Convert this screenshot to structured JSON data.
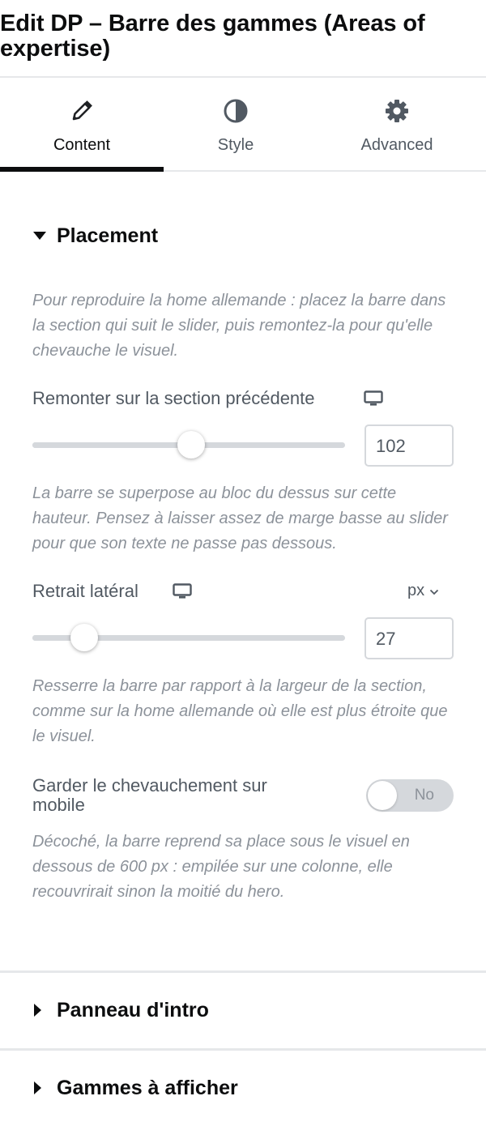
{
  "header": {
    "title": "Edit DP – Barre des gammes (Areas of expertise)"
  },
  "tabs": [
    {
      "label": "Content",
      "icon": "pencil-icon",
      "active": true
    },
    {
      "label": "Style",
      "icon": "half-circle-icon",
      "active": false
    },
    {
      "label": "Advanced",
      "icon": "gear-icon",
      "active": false
    }
  ],
  "placement": {
    "title": "Placement",
    "intro": "Pour reproduire la home allemande : placez la barre dans la section qui suit le slider, puis remontez-la pour qu'elle chevauche le visuel.",
    "remonter": {
      "label": "Remonter sur la section précédente",
      "value": "102",
      "slider_fraction": 0.51,
      "help": "La barre se superpose au bloc du dessus sur cette hauteur. Pensez à laisser assez de marge basse au slider pour que son texte ne passe pas dessous."
    },
    "retrait": {
      "label": "Retrait latéral",
      "unit": "px",
      "value": "27",
      "slider_fraction": 0.17,
      "help": "Resserre la barre par rapport à la largeur de la section, comme sur la home allemande où elle est plus étroite que le visuel."
    },
    "mobile": {
      "label": "Garder le chevauchement sur mobile",
      "toggle_label": "No",
      "checked": false,
      "help": "Décoché, la barre reprend sa place sous le visuel en dessous de 600 px : empilée sur une colonne, elle recouvrirait sinon la moitié du hero."
    }
  },
  "sections": [
    {
      "title": "Panneau d'intro"
    },
    {
      "title": "Gammes à afficher"
    }
  ],
  "colors": {
    "text": "#0c0d0e",
    "muted": "#8c929a",
    "label": "#515962",
    "track": "#d5d8dc"
  }
}
